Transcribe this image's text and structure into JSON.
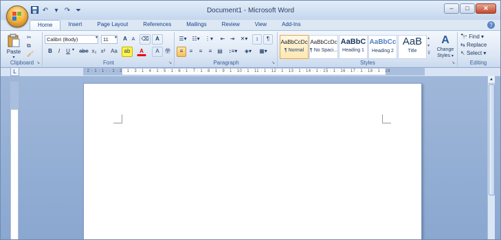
{
  "window": {
    "title": "Document1 - Microsoft Word"
  },
  "qat": {
    "save_icon": "save-icon",
    "undo_icon": "undo-icon",
    "redo_icon": "redo-icon",
    "customize_icon": "customize-qat-icon"
  },
  "tabs": [
    "Home",
    "Insert",
    "Page Layout",
    "References",
    "Mailings",
    "Review",
    "View",
    "Add-Ins"
  ],
  "clipboard": {
    "label": "Clipboard",
    "paste": "Paste"
  },
  "font": {
    "label": "Font",
    "name": "Calibri (Body)",
    "size": "11",
    "bold": "B",
    "italic": "I",
    "underline": "U",
    "strike": "abe",
    "sub": "x₂",
    "sup": "x²",
    "case": "Aa",
    "highlight": "ab",
    "color": "A",
    "grow": "A",
    "shrink": "A"
  },
  "paragraph": {
    "label": "Paragraph"
  },
  "styles": {
    "label": "Styles",
    "items": [
      {
        "sample": "AaBbCcDc",
        "name": "¶ Normal"
      },
      {
        "sample": "AaBbCcDc",
        "name": "¶ No Spaci..."
      },
      {
        "sample": "AaBbC",
        "name": "Heading 1"
      },
      {
        "sample": "AaBbCc",
        "name": "Heading 2"
      },
      {
        "sample": "AaB",
        "name": "Title"
      }
    ],
    "change": "Change Styles"
  },
  "editing": {
    "label": "Editing",
    "find": "Find",
    "replace": "Replace",
    "select": "Select"
  },
  "ruler": {
    "text": "· 2 · 1 · 1 · · 1 · 2 · 1 · 3 · 1 · 4 · 1 · 5 · 1 · 6 · 1 · 7 · 1 · 8 · 1 · 9 · 1 · 10 · 1 · 11 · 1 · 12 · 1 · 13 · 1 · 14 · 1 · 15 · 1 · 16 · 17 · 1 · 18 · 1 · 19"
  }
}
